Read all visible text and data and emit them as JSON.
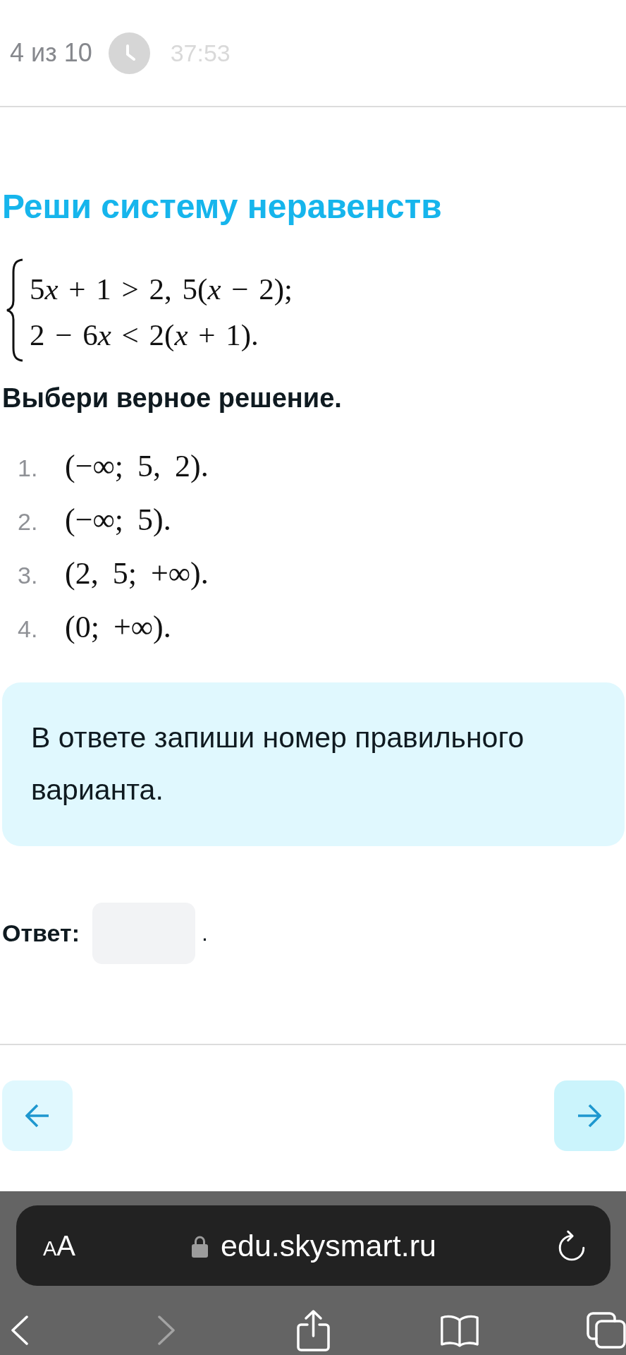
{
  "header": {
    "progress": "4 из 10",
    "timer": "37:53"
  },
  "task": {
    "title": "Реши систему неравенств",
    "system": [
      {
        "parts": [
          "5",
          "*x* + 1 > 2, 5(*x* − 2);"
        ]
      },
      {
        "parts": [
          "2 − 6",
          "*x* < 2(*x* + 1)."
        ]
      }
    ],
    "prompt": "Выбери верное решение.",
    "options": [
      {
        "number": "1.",
        "value": "(−∞; 5, 2)."
      },
      {
        "number": "2.",
        "value": "(−∞; 5)."
      },
      {
        "number": "3.",
        "value": "(2, 5; +∞)."
      },
      {
        "number": "4.",
        "value": "(0; +∞)."
      }
    ]
  },
  "hint": {
    "text": "В ответе запиши номер правильного варианта."
  },
  "answer": {
    "label": "Ответ:",
    "suffix": "."
  },
  "browser": {
    "text_size_button": "AA",
    "url": "edu.skysmart.ru",
    "toolbar": [
      {
        "kind": "back",
        "disabled": false
      },
      {
        "kind": "forward",
        "disabled": true
      },
      {
        "kind": "share",
        "disabled": false
      },
      {
        "kind": "bookmarks",
        "disabled": false
      },
      {
        "kind": "tabs",
        "disabled": false
      }
    ]
  }
}
